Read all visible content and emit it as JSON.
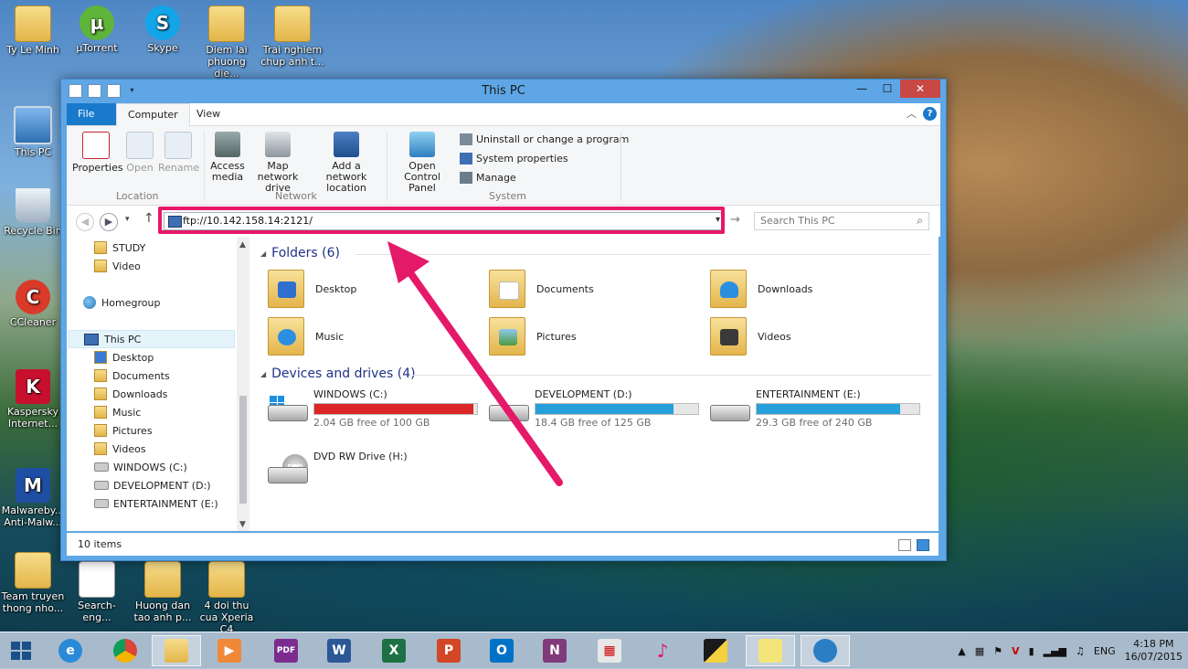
{
  "desktop": {
    "icons": [
      {
        "label": "Ty Le Minh"
      },
      {
        "label": "µTorrent"
      },
      {
        "label": "Skype"
      },
      {
        "label": "Diem lai phuong die..."
      },
      {
        "label": "Trai nghiem chup anh t..."
      },
      {
        "label": "This PC"
      },
      {
        "label": "Recycle Bin"
      },
      {
        "label": "CCleaner"
      },
      {
        "label": "Kaspersky Internet..."
      },
      {
        "label": "Malwareby... Anti-Malw..."
      },
      {
        "label": "Team truyen thong nho..."
      },
      {
        "label": "Search-eng..."
      },
      {
        "label": "Huong dan tao anh p..."
      },
      {
        "label": "4 doi thu cua Xperia C4"
      }
    ]
  },
  "window": {
    "title": "This PC",
    "controls": {
      "minimize": "—",
      "maximize": "☐",
      "close": "✕"
    }
  },
  "ribbon": {
    "tabs": {
      "file": "File",
      "computer": "Computer",
      "view": "View"
    },
    "location": {
      "properties": "Properties",
      "open": "Open",
      "rename": "Rename",
      "group": "Location"
    },
    "network": {
      "access_media": "Access media",
      "map_drive": "Map network drive",
      "add_location": "Add a network location",
      "group": "Network"
    },
    "system": {
      "control_panel": "Open Control Panel",
      "uninstall": "Uninstall or change a program",
      "sys_props": "System properties",
      "manage": "Manage",
      "group": "System"
    }
  },
  "address": {
    "url": "ftp://10.142.158.14:2121/",
    "search_placeholder": "Search This PC"
  },
  "nav": {
    "study": "STUDY",
    "video": "Video",
    "homegroup": "Homegroup",
    "thispc": "This PC",
    "desktop": "Desktop",
    "documents": "Documents",
    "downloads": "Downloads",
    "music": "Music",
    "pictures": "Pictures",
    "videos": "Videos",
    "win_c": "WINDOWS (C:)",
    "dev_d": "DEVELOPMENT (D:)",
    "ent_e": "ENTERTAINMENT (E:)"
  },
  "content": {
    "folders_header": "Folders (6)",
    "folders": [
      "Desktop",
      "Documents",
      "Downloads",
      "Music",
      "Pictures",
      "Videos"
    ],
    "drives_header": "Devices and drives (4)",
    "drives": [
      {
        "name": "WINDOWS (C:)",
        "free": "2.04 GB free of 100 GB",
        "used_fraction": 0.98,
        "color": "#da2626"
      },
      {
        "name": "DEVELOPMENT (D:)",
        "free": "18.4 GB free of 125 GB",
        "used_fraction": 0.85,
        "color": "#26a0da"
      },
      {
        "name": "ENTERTAINMENT (E:)",
        "free": "29.3 GB free of 240 GB",
        "used_fraction": 0.88,
        "color": "#26a0da"
      },
      {
        "name": "DVD RW Drive (H:)"
      }
    ]
  },
  "status": {
    "items": "10 items"
  },
  "tray": {
    "lang": "ENG",
    "time": "4:18 PM",
    "date": "16/07/2015"
  }
}
